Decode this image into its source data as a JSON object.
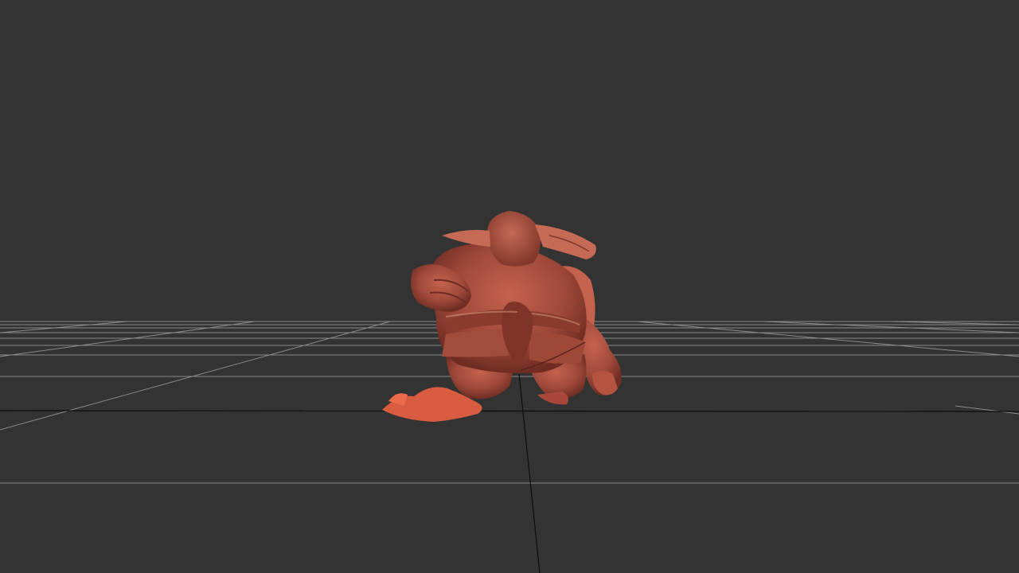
{
  "viewport": {
    "background": "#333333",
    "grid_color": "#8a8a8a",
    "axis_color": "#0d0d0d",
    "model": {
      "name": "sculpted-ogre-model",
      "base_color": "#a0493a",
      "highlight_color": "#c4624e",
      "shadow_color": "#6e2c22",
      "bright_color": "#ea6a4a"
    }
  }
}
